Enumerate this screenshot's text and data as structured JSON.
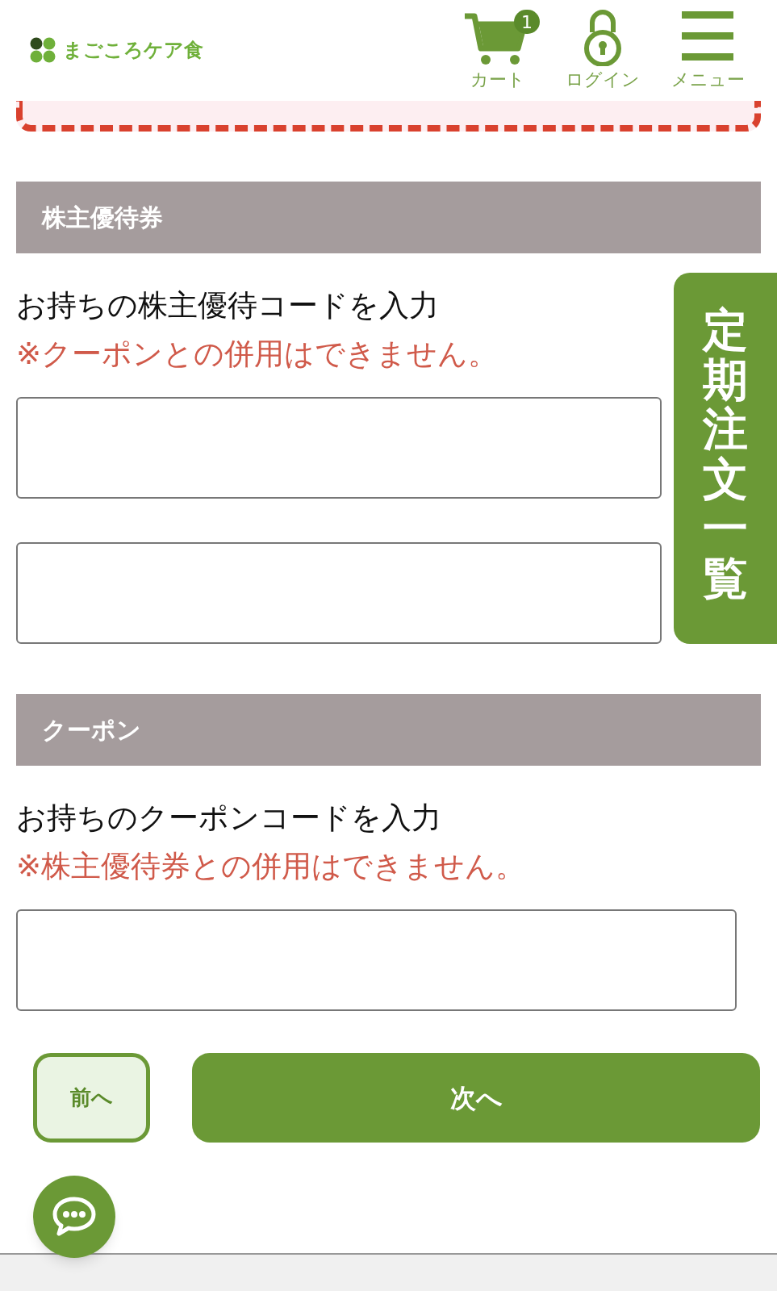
{
  "header": {
    "logo": "まごころケア食",
    "cart": {
      "label": "カート",
      "badge": "1"
    },
    "login": {
      "label": "ログイン"
    },
    "menu": {
      "label": "メニュー"
    }
  },
  "sections": [
    {
      "title": "株主優待券",
      "label": "お持ちの株主優待コードを入力",
      "note": "※クーポンとの併用はできません。",
      "fields": [
        {
          "kind": "text"
        },
        {
          "kind": "text"
        }
      ]
    },
    {
      "title": "クーポン",
      "label": "お持ちのクーポンコードを入力",
      "note": "※株主優待券との併用はできません。",
      "fields": [
        {
          "kind": "text"
        }
      ]
    }
  ],
  "side_tab": {
    "label": "定期注文一覧"
  },
  "buttons": {
    "prev": "前へ",
    "next": "次へ"
  }
}
